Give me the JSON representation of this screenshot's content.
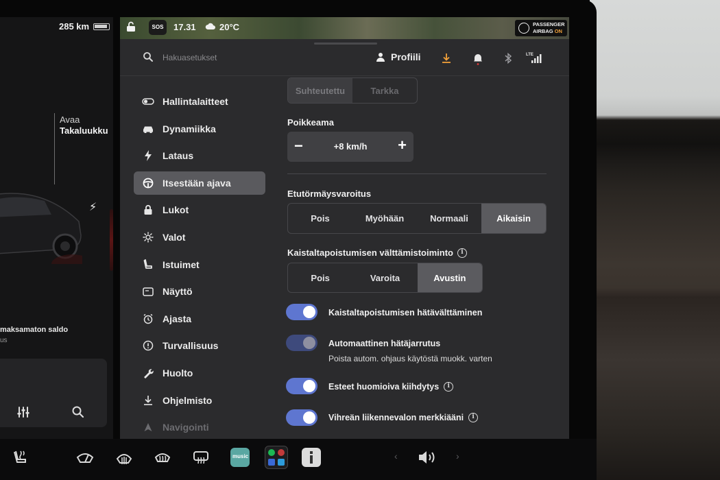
{
  "status_bar": {
    "range": "285 km",
    "time": "17.31",
    "weather": "20°C",
    "sos": "SOS",
    "airbag_line1": "PASSENGER",
    "airbag_line2": "AIRBAG",
    "airbag_state": "ON"
  },
  "left_pane": {
    "trunk_action": "Avaa",
    "trunk_label": "Takaluukku",
    "unpaid_balance": "maksamaton saldo",
    "unpaid_sub": "us"
  },
  "header": {
    "search_placeholder": "Hakuasetukset",
    "profile_label": "Profiili",
    "lte": "LTE"
  },
  "sidebar": {
    "items": [
      {
        "label": "Hallintalaitteet",
        "icon": "toggle-icon"
      },
      {
        "label": "Dynamiikka",
        "icon": "car-icon"
      },
      {
        "label": "Lataus",
        "icon": "bolt-icon"
      },
      {
        "label": "Itsestään ajava",
        "icon": "steering-wheel-icon",
        "active": true
      },
      {
        "label": "Lukot",
        "icon": "lock-icon"
      },
      {
        "label": "Valot",
        "icon": "sun-icon"
      },
      {
        "label": "Istuimet",
        "icon": "seat-icon"
      },
      {
        "label": "Näyttö",
        "icon": "display-icon"
      },
      {
        "label": "Ajasta",
        "icon": "alarm-clock-icon"
      },
      {
        "label": "Turvallisuus",
        "icon": "info-circle-icon"
      },
      {
        "label": "Huolto",
        "icon": "wrench-icon"
      },
      {
        "label": "Ohjelmisto",
        "icon": "download-icon"
      },
      {
        "label": "Navigointi",
        "icon": "navigation-icon"
      }
    ]
  },
  "content": {
    "speed_mode": {
      "options": [
        "Suhteutettu",
        "Tarkka"
      ],
      "selected": "Suhteutettu"
    },
    "offset": {
      "label": "Poikkeama",
      "value": "+8 km/h"
    },
    "forward_collision": {
      "label": "Etutörmäysvaroitus",
      "options": [
        "Pois",
        "Myöhään",
        "Normaali",
        "Aikaisin"
      ],
      "selected": "Aikaisin"
    },
    "lane_departure": {
      "label": "Kaistaltapoistumisen välttämistoiminto",
      "options": [
        "Pois",
        "Varoita",
        "Avustin"
      ],
      "selected": "Avustin"
    },
    "toggles": [
      {
        "label": "Kaistaltapoistumisen hätävälttäminen",
        "on": true
      },
      {
        "label": "Automaattinen hätäjarrutus",
        "sub": "Poista autom. ohjaus käytöstä muokk. varten",
        "on": true,
        "disabled": true
      },
      {
        "label": "Esteet huomioiva kiihdytys",
        "on": true,
        "info": true
      },
      {
        "label": "Vihreän liikennevalon merkkiääni",
        "on": true,
        "info": true
      }
    ]
  },
  "dock": {
    "music_label": "music"
  },
  "colors": {
    "toggle_on": "#5e76d0",
    "accent_orange": "#f2a13a",
    "panel_bg": "#2b2b2d"
  }
}
